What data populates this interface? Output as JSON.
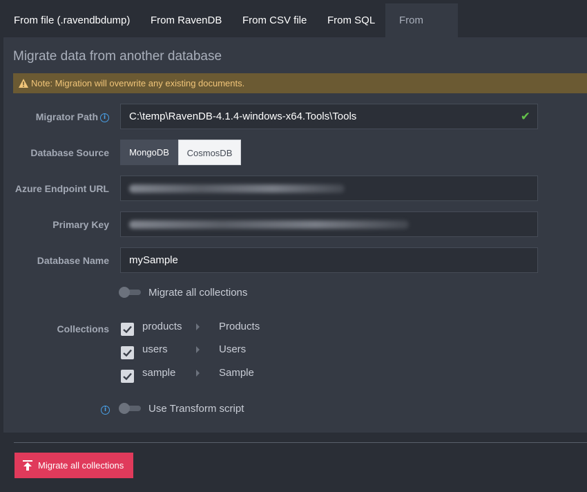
{
  "tabs": [
    {
      "label": "From file (.ravendbdump)",
      "active": false
    },
    {
      "label": "From RavenDB",
      "active": false
    },
    {
      "label": "From CSV file",
      "active": false
    },
    {
      "label": "From SQL",
      "active": false
    },
    {
      "label": "From other",
      "active": true
    }
  ],
  "panel": {
    "title": "Migrate data from another database",
    "alert": "Note: Migration will overwrite any existing documents."
  },
  "form": {
    "migrator_path_label": "Migrator Path",
    "migrator_path_value": "C:\\temp\\RavenDB-4.1.4-windows-x64.Tools\\Tools",
    "database_source_label": "Database Source",
    "source_options": [
      "MongoDB",
      "CosmosDB"
    ],
    "source_selected": "CosmosDB",
    "azure_endpoint_label": "Azure Endpoint URL",
    "primary_key_label": "Primary Key",
    "database_name_label": "Database Name",
    "database_name_value": "mySample",
    "migrate_all_label": "Migrate all collections",
    "migrate_all_enabled": false,
    "collections_label": "Collections",
    "collections": [
      {
        "name": "products",
        "target": "Products",
        "checked": true
      },
      {
        "name": "users",
        "target": "Users",
        "checked": true
      },
      {
        "name": "sample",
        "target": "Sample",
        "checked": true
      }
    ],
    "transform_label": "Use Transform script",
    "transform_enabled": false
  },
  "footer": {
    "migrate_button": "Migrate all collections"
  },
  "colors": {
    "accent": "#e03a5b",
    "alert_bg": "#6b5a33",
    "alert_text": "#f1c579",
    "success": "#63c24a",
    "info": "#4aa0e6"
  }
}
